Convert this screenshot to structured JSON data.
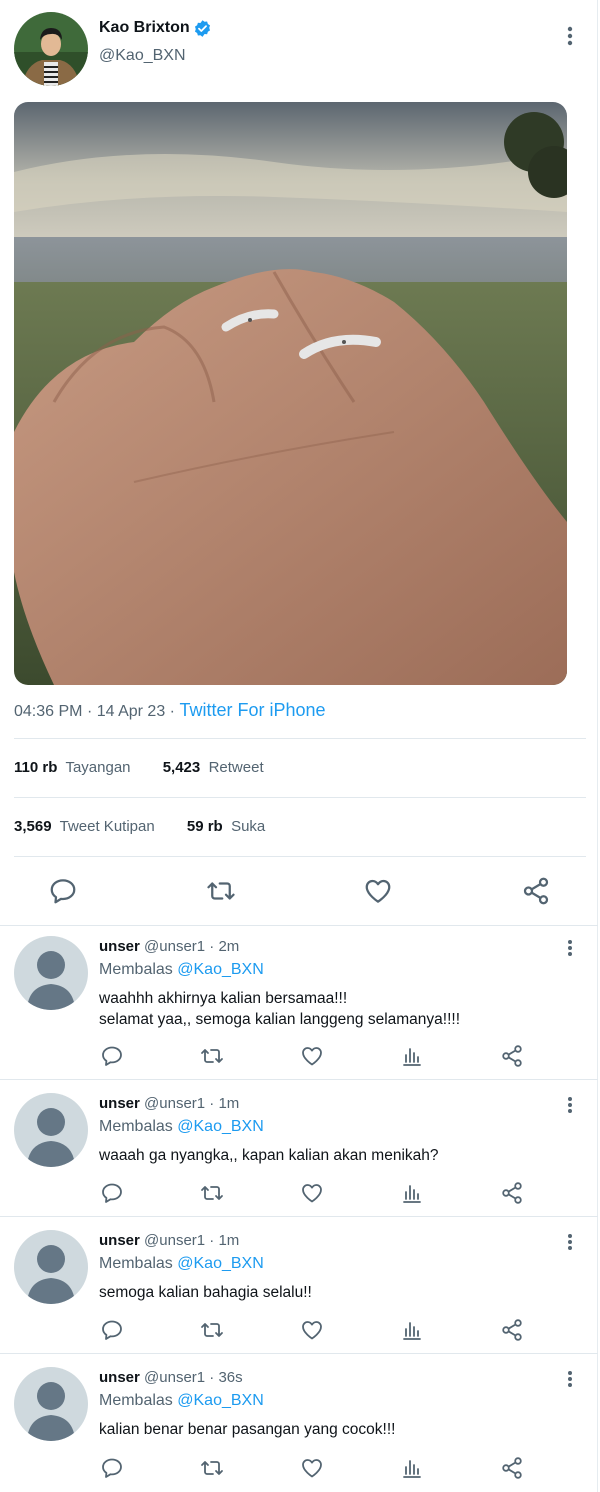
{
  "tweet": {
    "author_name": "Kao Brixton",
    "author_handle": "@Kao_BXN",
    "time": "04:36 PM",
    "date": "14 Apr 23",
    "separator": "·",
    "source": "Twitter For iPhone",
    "stats": {
      "views_count": "110 rb",
      "views_label": "Tayangan",
      "retweets_count": "5,423",
      "retweets_label": "Retweet",
      "quotes_count": "3,569",
      "quotes_label": "Tweet Kutipan",
      "likes_count": "59 rb",
      "likes_label": "Suka"
    },
    "icons": [
      "verified-badge-icon",
      "more-options-icon",
      "reply-icon",
      "retweet-icon",
      "like-icon",
      "share-icon",
      "views-icon"
    ]
  },
  "replies": [
    {
      "name": "unser",
      "handle": "@unser1",
      "time": "2m",
      "replying_prefix": "Membalas",
      "replying_to": "@Kao_BXN",
      "text_lines": [
        "waahhh akhirnya kalian bersamaa!!!",
        "selamat yaa,, semoga kalian langgeng selamanya!!!!"
      ]
    },
    {
      "name": "unser",
      "handle": "@unser1",
      "time": "1m",
      "replying_prefix": "Membalas",
      "replying_to": "@Kao_BXN",
      "text_lines": [
        "waaah ga nyangka,, kapan kalian akan menikah?"
      ]
    },
    {
      "name": "unser",
      "handle": "@unser1",
      "time": "1m",
      "replying_prefix": "Membalas",
      "replying_to": "@Kao_BXN",
      "text_lines": [
        "semoga kalian bahagia selalu!!"
      ]
    },
    {
      "name": "unser",
      "handle": "@unser1",
      "time": "36s",
      "replying_prefix": "Membalas",
      "replying_to": "@Kao_BXN",
      "text_lines": [
        "kalian benar benar pasangan yang cocok!!!"
      ]
    }
  ],
  "colors": {
    "accent": "#1d9bf0",
    "secondary_text": "#536471",
    "divider": "#e1e8ed"
  }
}
